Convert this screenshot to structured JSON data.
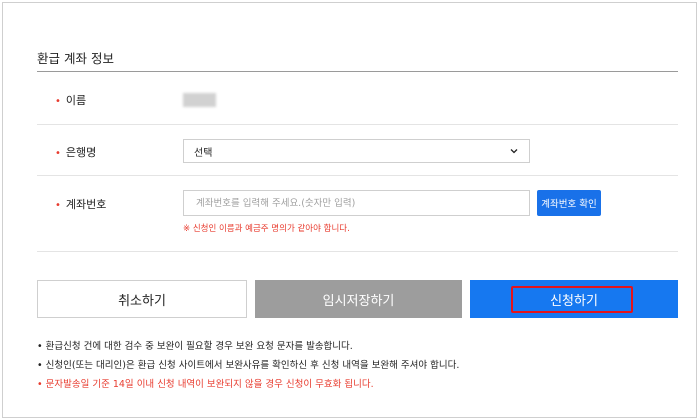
{
  "form": {
    "section_title": "환급 계좌 정보",
    "name_label": "이름",
    "bank_label": "은행명",
    "bank_selected": "선택",
    "account_label": "계좌번호",
    "account_value": "",
    "account_placeholder": "계좌번호를 입력해 주세요.(숫자만 입력)",
    "verify_button": "계좌번호 확인",
    "name_hint": "※ 신청인 이름과 예금주 명의가 같아야 합니다.",
    "required_mark": "•"
  },
  "buttons": {
    "cancel": "취소하기",
    "temp_save": "임시저장하기",
    "submit": "신청하기"
  },
  "notes": [
    "• 환급신청 건에 대한 검수 중 보완이 필요할 경우 보완 요청 문자를 발송합니다.",
    "• 신청인(또는 대리인)은 환급 신청 사이트에서 보완사유를 확인하신 후 신청 내역을 보완해 주셔야 합니다.",
    "• 문자발송일 기준 14일 이내 신청 내역이 보완되지 않을 경우 신청이 무효화 됩니다."
  ],
  "colors": {
    "primary": "#1678f0",
    "disabled": "#9d9d9d",
    "required": "#e83b2e",
    "highlight": "#e5131a"
  },
  "icons": {
    "select_arrow": "chevron-down-icon"
  }
}
